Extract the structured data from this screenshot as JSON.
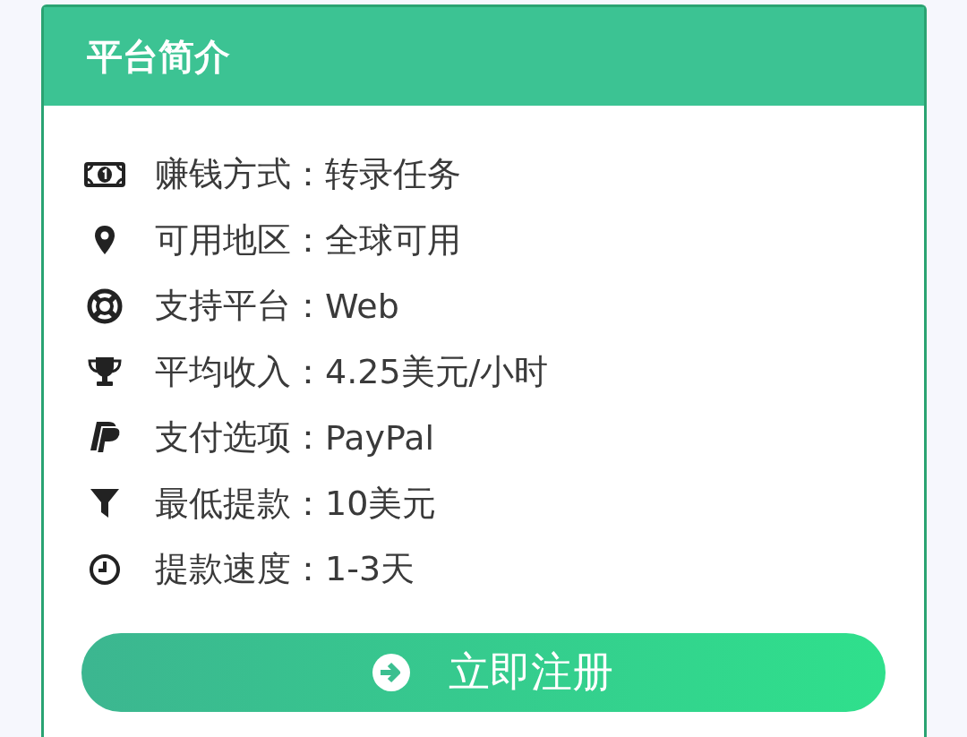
{
  "card": {
    "title": "平台简介"
  },
  "details": [
    {
      "kind": "money",
      "label": "赚钱方式：",
      "value": "转录任务"
    },
    {
      "kind": "pin",
      "label": "可用地区：",
      "value": "全球可用"
    },
    {
      "kind": "lifering",
      "label": "支持平台：",
      "value": "Web"
    },
    {
      "kind": "trophy",
      "label": "平均收入：",
      "value": "4.25美元/小时"
    },
    {
      "kind": "paypal",
      "label": "支付选项：",
      "value": "PayPal"
    },
    {
      "kind": "filter",
      "label": "最低提款：",
      "value": "10美元"
    },
    {
      "kind": "clock",
      "label": "提款速度：",
      "value": "1-3天"
    }
  ],
  "button": {
    "label": "立即注册"
  }
}
